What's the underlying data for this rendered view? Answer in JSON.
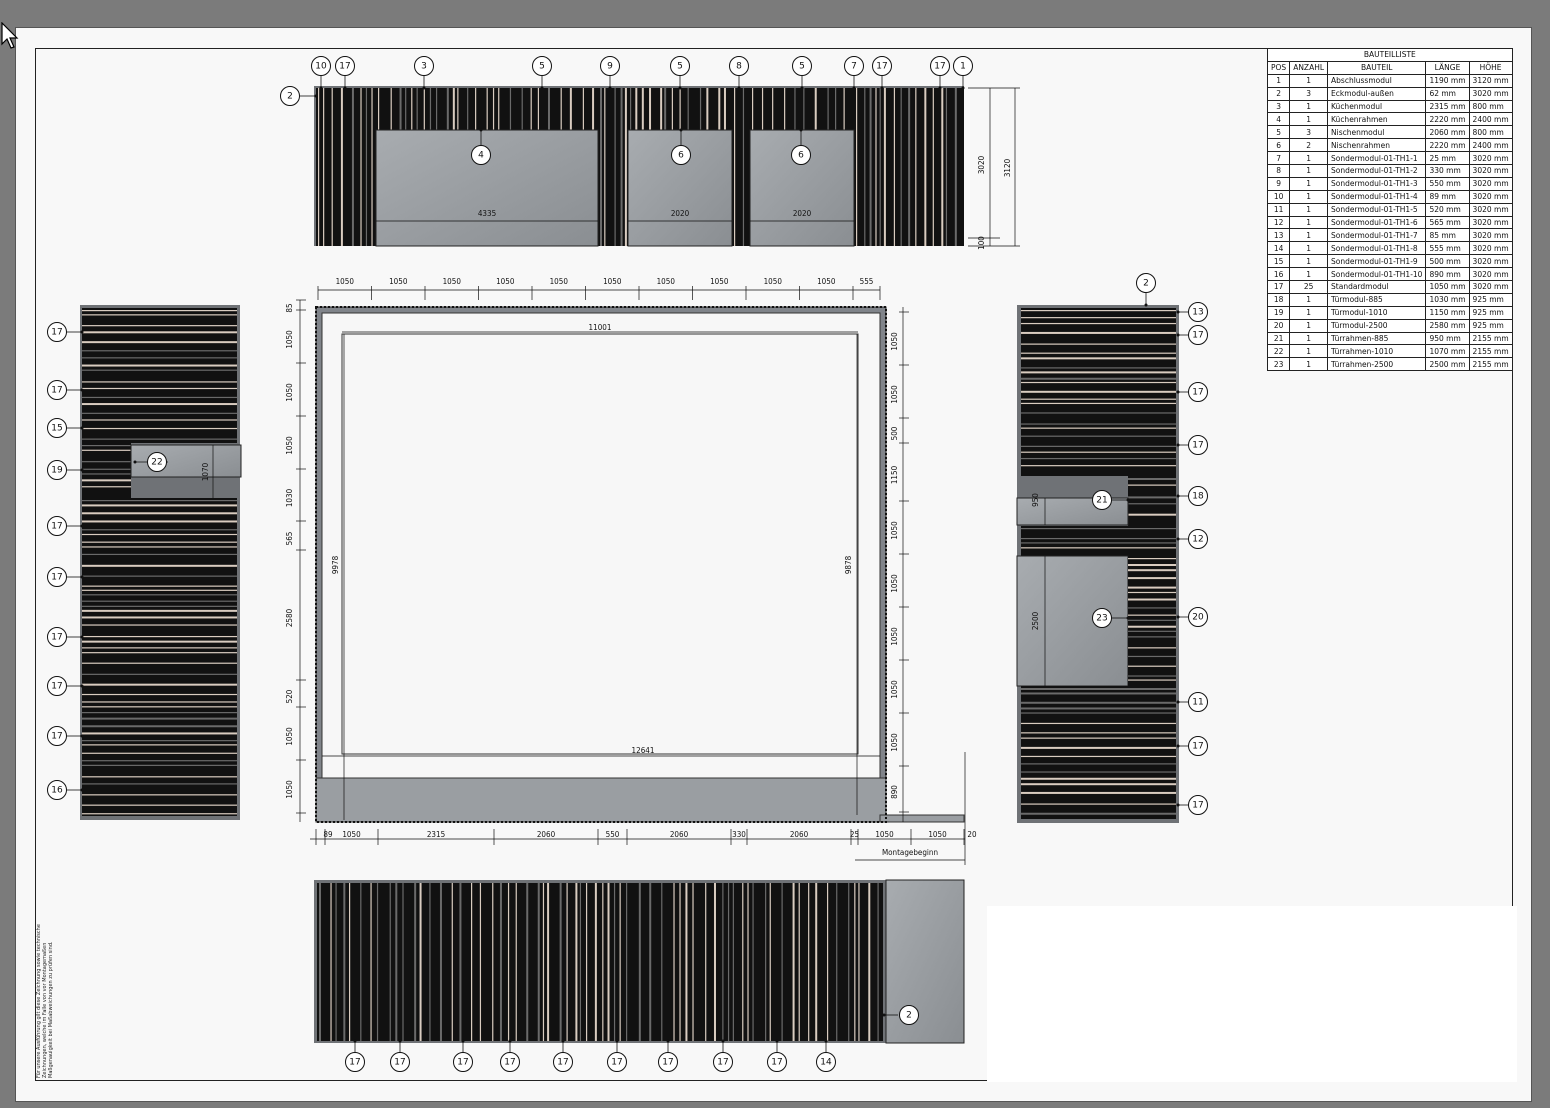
{
  "parts_list": {
    "title": "BAUTEILLISTE",
    "headers": [
      "POS",
      "ANZAHL",
      "BAUTEIL",
      "LÄNGE",
      "HÖHE"
    ],
    "rows": [
      [
        "1",
        "1",
        "Abschlussmodul",
        "1190 mm",
        "3120 mm"
      ],
      [
        "2",
        "3",
        "Eckmodul-außen",
        "62 mm",
        "3020 mm"
      ],
      [
        "3",
        "1",
        "Küchenmodul",
        "2315 mm",
        "800 mm"
      ],
      [
        "4",
        "1",
        "Küchenrahmen",
        "2220 mm",
        "2400 mm"
      ],
      [
        "5",
        "3",
        "Nischenmodul",
        "2060 mm",
        "800 mm"
      ],
      [
        "6",
        "2",
        "Nischenrahmen",
        "2220 mm",
        "2400 mm"
      ],
      [
        "7",
        "1",
        "Sondermodul-01-TH1-1",
        "25 mm",
        "3020 mm"
      ],
      [
        "8",
        "1",
        "Sondermodul-01-TH1-2",
        "330 mm",
        "3020 mm"
      ],
      [
        "9",
        "1",
        "Sondermodul-01-TH1-3",
        "550 mm",
        "3020 mm"
      ],
      [
        "10",
        "1",
        "Sondermodul-01-TH1-4",
        "89 mm",
        "3020 mm"
      ],
      [
        "11",
        "1",
        "Sondermodul-01-TH1-5",
        "520 mm",
        "3020 mm"
      ],
      [
        "12",
        "1",
        "Sondermodul-01-TH1-6",
        "565 mm",
        "3020 mm"
      ],
      [
        "13",
        "1",
        "Sondermodul-01-TH1-7",
        "85 mm",
        "3020 mm"
      ],
      [
        "14",
        "1",
        "Sondermodul-01-TH1-8",
        "555 mm",
        "3020 mm"
      ],
      [
        "15",
        "1",
        "Sondermodul-01-TH1-9",
        "500 mm",
        "3020 mm"
      ],
      [
        "16",
        "1",
        "Sondermodul-01-TH1-10",
        "890 mm",
        "3020 mm"
      ],
      [
        "17",
        "25",
        "Standardmodul",
        "1050 mm",
        "3020 mm"
      ],
      [
        "18",
        "1",
        "Türmodul-885",
        "1030 mm",
        "925 mm"
      ],
      [
        "19",
        "1",
        "Türmodul-1010",
        "1150 mm",
        "925 mm"
      ],
      [
        "20",
        "1",
        "Türmodul-2500",
        "2580 mm",
        "925 mm"
      ],
      [
        "21",
        "1",
        "Türrahmen-885",
        "950 mm",
        "2155 mm"
      ],
      [
        "22",
        "1",
        "Türrahmen-1010",
        "1070 mm",
        "2155 mm"
      ],
      [
        "23",
        "1",
        "Türrahmen-2500",
        "2500 mm",
        "2155 mm"
      ]
    ]
  },
  "top_elevation": {
    "callouts_top": [
      "10",
      "17",
      "3",
      "5",
      "9",
      "5",
      "8",
      "5",
      "7",
      "17",
      "17",
      "1"
    ],
    "callout_left": "2",
    "frame_callouts": [
      "4",
      "6",
      "6"
    ],
    "opening_dims": [
      "4335",
      "2020",
      "2020"
    ],
    "height_dims": [
      "3020",
      "3120",
      "100"
    ]
  },
  "plan": {
    "top_dims": [
      "1050",
      "1050",
      "1050",
      "1050",
      "1050",
      "1050",
      "1050",
      "1050",
      "1050",
      "1050",
      "555"
    ],
    "left_dims": [
      "85",
      "1050",
      "1050",
      "1050",
      "1030",
      "565",
      "2580",
      "520",
      "1050",
      "1050"
    ],
    "right_dims": [
      "1050",
      "1050",
      "500",
      "1150",
      "1050",
      "1050",
      "1050",
      "1050",
      "1050",
      "890"
    ],
    "bottom_dims": [
      "89",
      "1050",
      "2315",
      "2060",
      "550",
      "2060",
      "330",
      "2060",
      "25",
      "1050",
      "1050",
      "20"
    ],
    "inner_width": "11001",
    "outer_width": "12641",
    "inner_left_height": "9978",
    "inner_right_height": "9878",
    "start_label": "Montagebeginn"
  },
  "left_elevation": {
    "callouts": [
      "17",
      "17",
      "15",
      "19",
      "17",
      "17",
      "17",
      "17",
      "17",
      "16"
    ],
    "frame_callout": "22",
    "door_dim": "1070"
  },
  "right_elevation": {
    "callouts": [
      "13",
      "17",
      "17",
      "17",
      "18",
      "12",
      "20",
      "11",
      "17",
      "17"
    ],
    "top_callout": "2",
    "frame_callouts": [
      "21",
      "23"
    ],
    "door_dims": [
      "950",
      "2500"
    ]
  },
  "bottom_elevation": {
    "callouts": [
      "17",
      "17",
      "17",
      "17",
      "17",
      "17",
      "17",
      "17",
      "17",
      "14"
    ],
    "side_callout": "2"
  },
  "notes": "Für unsere Ausführung gilt diese Zeichnung sowie technische Zeichnungen, welche im Falle von vor Montagemaßen Maßgenauigkeit bei Maßabweichungen zu prüfen sind."
}
